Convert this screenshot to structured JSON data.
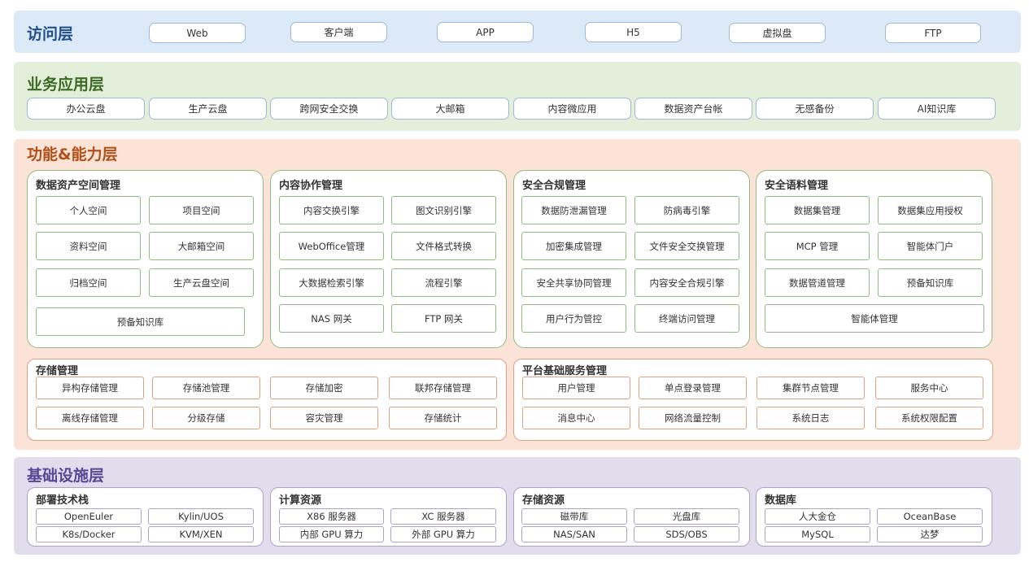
{
  "colors": {
    "access_bg": "#dce9f6",
    "business_bg": "#e3efdb",
    "function_bg": "#fbe3d7",
    "infra_bg": "#e1ddec",
    "access_title": "#1f4e8a",
    "business_title": "#3b6b22",
    "function_title": "#b2501a",
    "infra_title": "#5a4794"
  },
  "access": {
    "title": "访问层",
    "items": [
      "Web",
      "客户端",
      "APP",
      "H5",
      "虚拟盘",
      "FTP"
    ]
  },
  "business": {
    "title": "业务应用层",
    "items": [
      "办公云盘",
      "生产云盘",
      "跨网安全交换",
      "大邮箱",
      "内容微应用",
      "数据资产台帐",
      "无感备份",
      "AI知识库"
    ]
  },
  "function": {
    "title": "功能&能力层",
    "panels": [
      {
        "title": "数据资产空间管理",
        "items": [
          "个人空间",
          "项目空间",
          "资料空间",
          "大邮箱空间",
          "归档空间",
          "生产云盘空间",
          "预备知识库"
        ]
      },
      {
        "title": "内容协作管理",
        "items": [
          "内容交换引擎",
          "图文识别引擎",
          "WebOffice管理",
          "文件格式转换",
          "大数据检索引擎",
          "流程引擎",
          "NAS 网关",
          "FTP 网关"
        ]
      },
      {
        "title": "安全合规管理",
        "items": [
          "数据防泄漏管理",
          "防病毒引擎",
          "加密集成管理",
          "文件安全交换管理",
          "安全共享协同管理",
          "内容安全合规引擎",
          "用户行为管控",
          "终端访问管理"
        ]
      },
      {
        "title": "安全语料管理",
        "items": [
          "数据集管理",
          "数据集应用授权",
          "MCP 管理",
          "智能体门户",
          "数据管道管理",
          "预备知识库",
          "智能体管理"
        ]
      }
    ],
    "storage": {
      "title": "存储管理",
      "items": [
        "异构存储管理",
        "存储池管理",
        "存储加密",
        "联邦存储管理",
        "离线存储管理",
        "分级存储",
        "容灾管理",
        "存储统计"
      ]
    },
    "platform": {
      "title": "平台基础服务管理",
      "items": [
        "用户管理",
        "单点登录管理",
        "集群节点管理",
        "服务中心",
        "消息中心",
        "网络流量控制",
        "系统日志",
        "系统权限配置"
      ]
    }
  },
  "infra": {
    "title": "基础设施层",
    "panels": [
      {
        "title": "部署技术栈",
        "items": [
          "OpenEuler",
          "Kylin/UOS",
          "K8s/Docker",
          "KVM/XEN"
        ]
      },
      {
        "title": "计算资源",
        "items": [
          "X86 服务器",
          "XC 服务器",
          "内部 GPU 算力",
          "外部 GPU 算力"
        ]
      },
      {
        "title": "存储资源",
        "items": [
          "磁带库",
          "光盘库",
          "NAS/SAN",
          "SDS/OBS"
        ]
      },
      {
        "title": "数据库",
        "items": [
          "人大金仓",
          "OceanBase",
          "MySQL",
          "达梦"
        ]
      }
    ]
  }
}
